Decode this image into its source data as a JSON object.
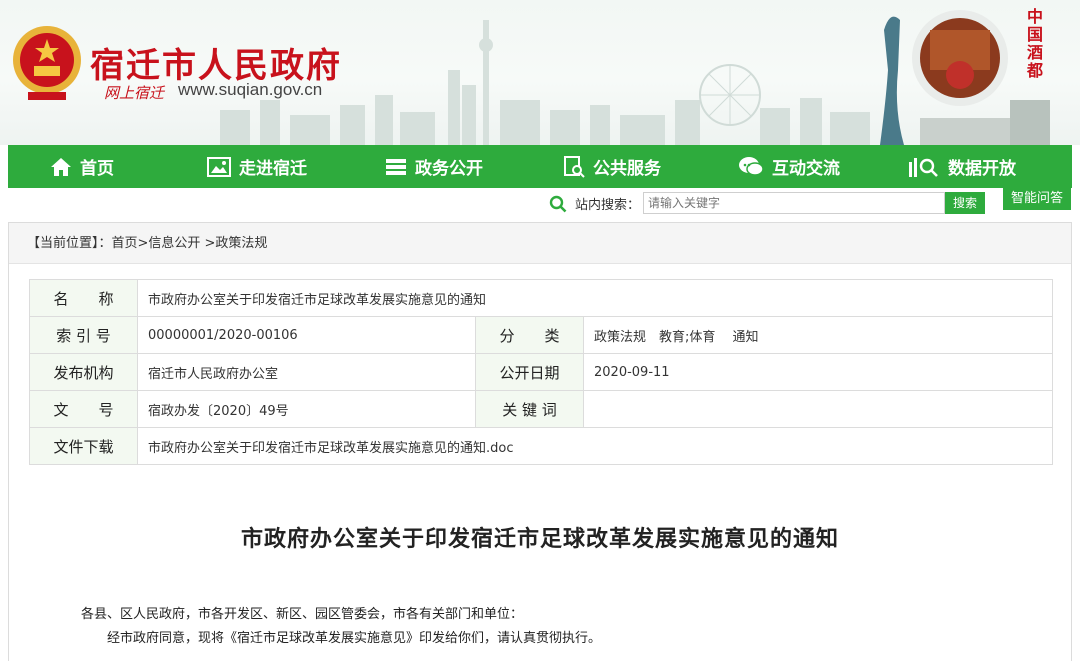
{
  "header": {
    "site_name": "宿迁市人民政府",
    "slogan": "网上宿迁",
    "url": "www.suqian.gov.cn",
    "wine_tag": "中国酒都"
  },
  "nav": {
    "items": [
      {
        "label": "首页",
        "icon": "home-icon"
      },
      {
        "label": "走进宿迁",
        "icon": "picture-icon"
      },
      {
        "label": "政务公开",
        "icon": "list-icon"
      },
      {
        "label": "公共服务",
        "icon": "document-search-icon"
      },
      {
        "label": "互动交流",
        "icon": "chat-icon"
      },
      {
        "label": "数据开放",
        "icon": "data-search-icon"
      }
    ]
  },
  "search": {
    "label": "站内搜索：",
    "placeholder": "请输入关键字",
    "button": "搜索",
    "smart_qa": "智能问答"
  },
  "breadcrumb": {
    "prefix": "【当前位置】：",
    "path": "首页>信息公开 >政策法规"
  },
  "meta": {
    "name_label": "名　　称",
    "name_value": "市政府办公室关于印发宿迁市足球改革发展实施意见的通知",
    "index_label": "索 引 号",
    "index_value": "00000001/2020-00106",
    "category_label": "分　　类",
    "category_value": "政策法规　教育;体育　 通知",
    "org_label": "发布机构",
    "org_value": "宿迁市人民政府办公室",
    "date_label": "公开日期",
    "date_value": "2020-09-11",
    "docno_label": "文　　号",
    "docno_value": "宿政办发〔2020〕49号",
    "keyword_label": "关 键 词",
    "keyword_value": "",
    "download_label": "文件下载",
    "download_value": "市政府办公室关于印发宿迁市足球改革发展实施意见的通知.doc"
  },
  "document": {
    "title": "市政府办公室关于印发宿迁市足球改革发展实施意见的通知",
    "addressee": "各县、区人民政府，市各开发区、新区、园区管委会，市各有关部门和单位：",
    "body": "经市政府同意，现将《宿迁市足球改革发展实施意见》印发给你们，请认真贯彻执行。"
  },
  "colors": {
    "brand_red": "#c8121c",
    "nav_green": "#2eab3d"
  }
}
